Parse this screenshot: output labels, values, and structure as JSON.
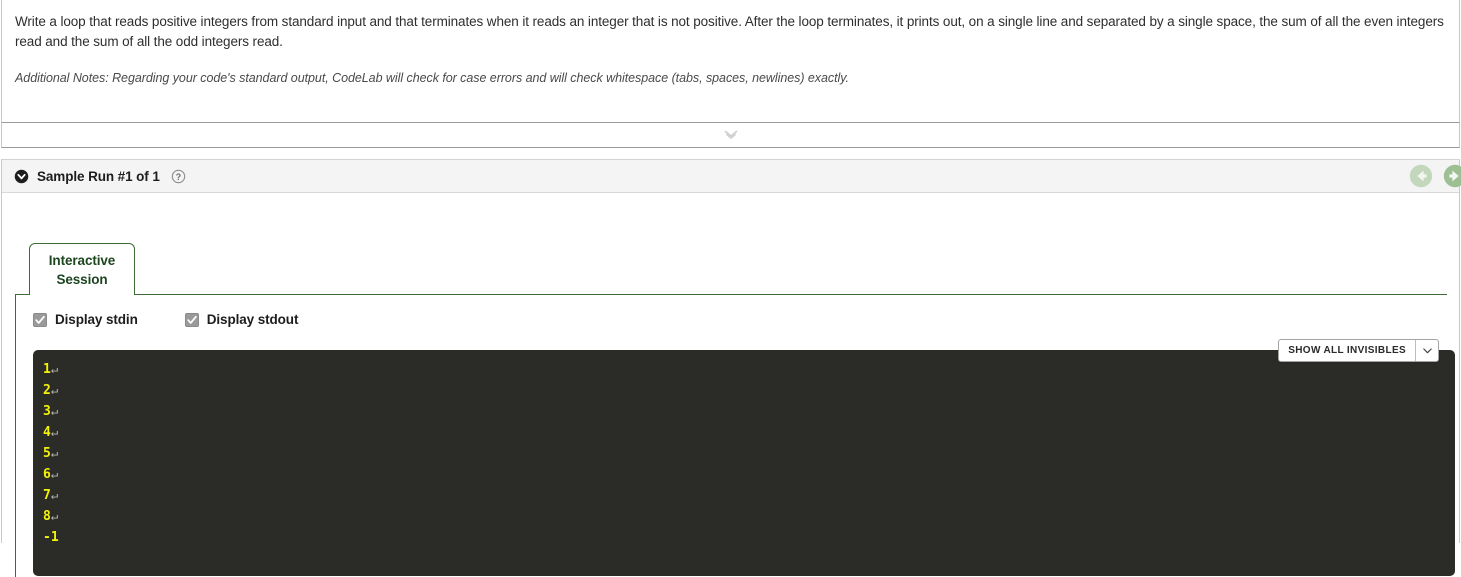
{
  "prompt": {
    "statement": "Write a loop that reads positive integers from standard input and that terminates when it reads an integer that is not positive. After the loop terminates, it prints out, on a single line and separated by a single space, the sum of all the even integers read and the sum of all the odd integers read.",
    "notes": "Additional Notes: Regarding your code's standard output, CodeLab will check for case errors and will check whitespace (tabs, spaces, newlines) exactly."
  },
  "collapse_strip": {
    "icon": "double-chevron-down-icon"
  },
  "run_panel": {
    "title": "Sample Run #1 of 1",
    "collapse_icon": "chevron-down-circle-icon",
    "help_icon": "help-circle-icon",
    "nav": {
      "prev_icon": "arrow-left-circle-icon",
      "next_icon": "arrow-right-circle-icon",
      "accent_color": "#c2d7bc"
    },
    "tabs": [
      {
        "label_line1": "Interactive",
        "label_line2": "Session",
        "active": true
      }
    ],
    "border_color": "#3f6b38"
  },
  "options": {
    "checkboxes": [
      {
        "label": "Display stdin",
        "checked": true
      },
      {
        "label": "Display stdout",
        "checked": true
      }
    ],
    "invisibles_button": {
      "label": "SHOW ALL INVISIBLES",
      "caret_icon": "chevron-down-icon"
    }
  },
  "terminal": {
    "background": "#2b2b28",
    "stdin_color": "#f2f20a",
    "newline_glyph": "↵",
    "lines": [
      {
        "text": "1",
        "newline": true
      },
      {
        "text": "2",
        "newline": true
      },
      {
        "text": "3",
        "newline": true
      },
      {
        "text": "4",
        "newline": true
      },
      {
        "text": "5",
        "newline": true
      },
      {
        "text": "6",
        "newline": true
      },
      {
        "text": "7",
        "newline": true
      },
      {
        "text": "8",
        "newline": true
      },
      {
        "text": "-1",
        "newline": false
      }
    ]
  }
}
